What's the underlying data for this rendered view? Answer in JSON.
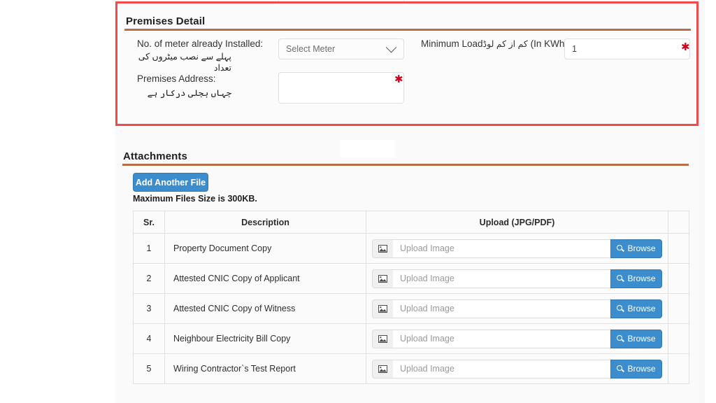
{
  "theme": {
    "highlight_border": "#ef4b4b",
    "heading_rule": "#a9562c",
    "primary_button": "#3c8dcd",
    "required_star": "#d0021b"
  },
  "premises": {
    "title": "Premises Detail",
    "meter_label": "No. of meter already Installed:",
    "meter_label_urdu": "پہلے سے نصب میٹروں کی تعداد",
    "meter_select_value": "Select Meter",
    "address_label": "Premises Address:",
    "address_label_urdu": "جہاں بجلی درکار ہے",
    "address_value": "",
    "address_placeholder": "",
    "load_label_prefix": "Minimum Load",
    "load_label_urdu": "کم از کم لوڈ",
    "load_label_suffix": "(In KWh):",
    "load_value": "1",
    "required_marker": "✱"
  },
  "attachments": {
    "title": "Attachments",
    "add_file_label": "Add Another File",
    "max_size_note": "Maximum Files Size is 300KB.",
    "columns": {
      "sr": "Sr.",
      "description": "Description",
      "upload": "Upload (JPG/PDF)",
      "blank": ""
    },
    "upload_placeholder": "Upload Image",
    "browse_label": "Browse",
    "rows": [
      {
        "sr": "1",
        "description": "Property Document Copy"
      },
      {
        "sr": "2",
        "description": "Attested CNIC Copy of Applicant"
      },
      {
        "sr": "3",
        "description": "Attested CNIC Copy of Witness"
      },
      {
        "sr": "4",
        "description": "Neighbour Electricity Bill Copy"
      },
      {
        "sr": "5",
        "description": "Wiring Contractor`s Test Report"
      }
    ]
  }
}
